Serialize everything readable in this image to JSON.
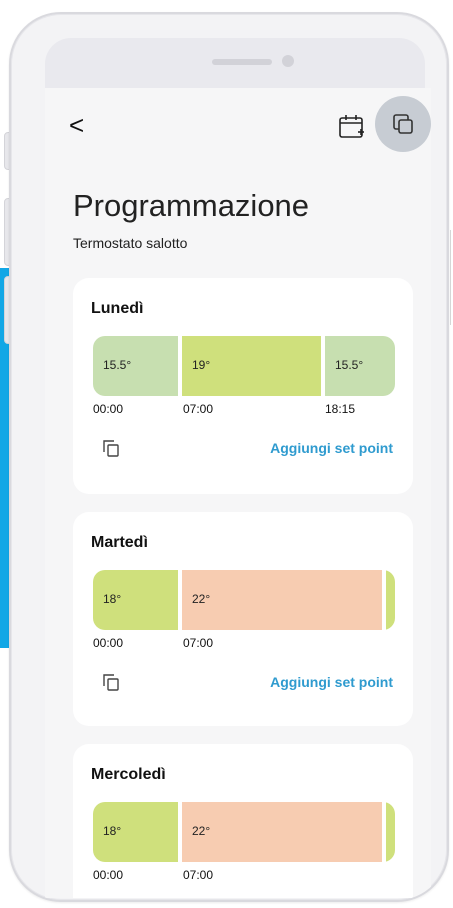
{
  "header": {
    "back_label": "<",
    "title": "Programmazione",
    "subtitle": "Termostato salotto",
    "calendar_icon": "calendar-plus-icon",
    "copy_icon": "copy-icon"
  },
  "days": [
    {
      "name": "Lunedì",
      "segments": [
        {
          "label": "15.5°",
          "color": "#c7dfb0"
        },
        {
          "label": "19°",
          "color": "#cfe07c"
        },
        {
          "label": "15.5°",
          "color": "#c7dfb0"
        }
      ],
      "times": [
        "00:00",
        "07:00",
        "18:15"
      ],
      "add_label": "Aggiungi set point"
    },
    {
      "name": "Martedì",
      "segments": [
        {
          "label": "18°",
          "color": "#cfe07c"
        },
        {
          "label": "22°",
          "color": "#f7ccb1"
        },
        {
          "label": "",
          "color": "#cfe07c"
        }
      ],
      "times": [
        "00:00",
        "07:00"
      ],
      "add_label": "Aggiungi set point"
    },
    {
      "name": "Mercoledì",
      "segments": [
        {
          "label": "18°",
          "color": "#cfe07c"
        },
        {
          "label": "22°",
          "color": "#f7ccb1"
        },
        {
          "label": "",
          "color": "#cfe07c"
        }
      ],
      "times": [
        "00:00",
        "07:00"
      ]
    }
  ],
  "colors": {
    "link": "#2f9bcf",
    "accent": "#12a7e6"
  }
}
